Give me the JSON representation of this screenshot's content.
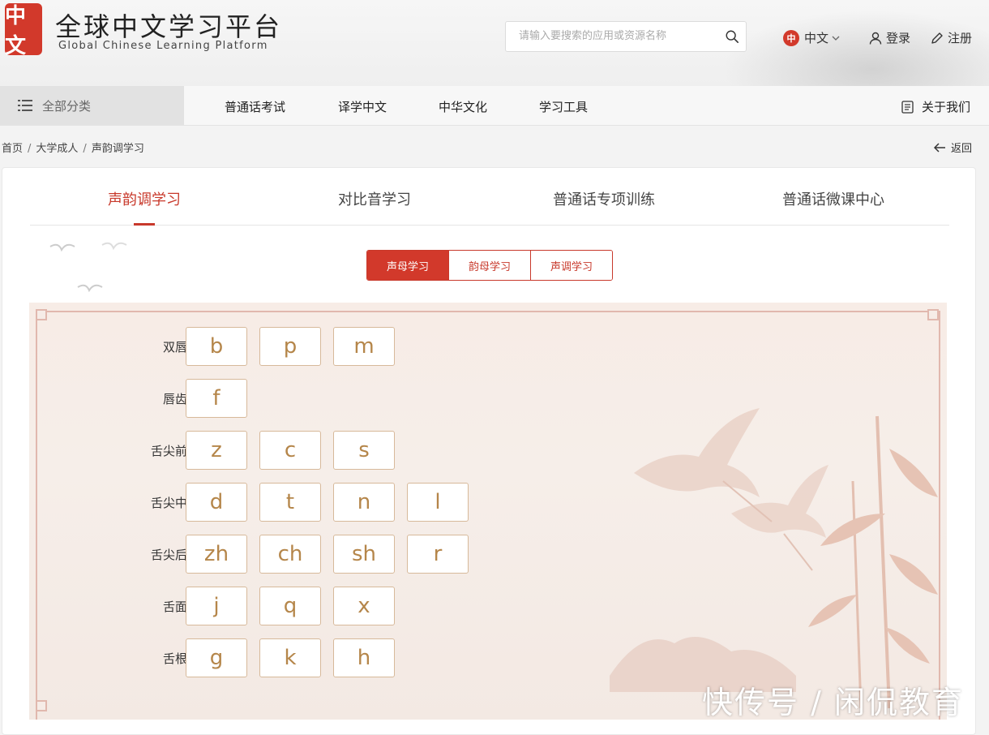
{
  "header": {
    "logo_seal": "中文",
    "title": "全球中文学习平台",
    "subtitle": "Global Chinese Learning Platform",
    "search_placeholder": "请输入要搜索的应用或资源名称",
    "lang_badge": "中",
    "lang_label": "中文",
    "login_label": "登录",
    "register_label": "注册"
  },
  "nav": {
    "all_categories": "全部分类",
    "items": [
      "普通话考试",
      "译学中文",
      "中华文化",
      "学习工具"
    ],
    "about": "关于我们"
  },
  "breadcrumb": {
    "items": [
      "首页",
      "大学成人",
      "声韵调学习"
    ],
    "back": "返回"
  },
  "tabs": [
    "声韵调学习",
    "对比音学习",
    "普通话专项训练",
    "普通话微课中心"
  ],
  "active_tab": 0,
  "segments": [
    "声母学习",
    "韵母学习",
    "声调学习"
  ],
  "active_segment": 0,
  "groups": [
    {
      "label": "双唇音",
      "keys": [
        "b",
        "p",
        "m"
      ]
    },
    {
      "label": "唇齿音",
      "keys": [
        "f"
      ]
    },
    {
      "label": "舌尖前音",
      "keys": [
        "z",
        "c",
        "s"
      ]
    },
    {
      "label": "舌尖中音",
      "keys": [
        "d",
        "t",
        "n",
        "l"
      ]
    },
    {
      "label": "舌尖后音",
      "keys": [
        "zh",
        "ch",
        "sh",
        "r"
      ]
    },
    {
      "label": "舌面音",
      "keys": [
        "j",
        "q",
        "x"
      ]
    },
    {
      "label": "舌根音",
      "keys": [
        "g",
        "k",
        "h"
      ]
    }
  ],
  "watermark": "快传号 / 闲侃教育",
  "colors": {
    "accent": "#d2392b",
    "key_text": "#b5864a",
    "key_border": "#d7b99a"
  }
}
